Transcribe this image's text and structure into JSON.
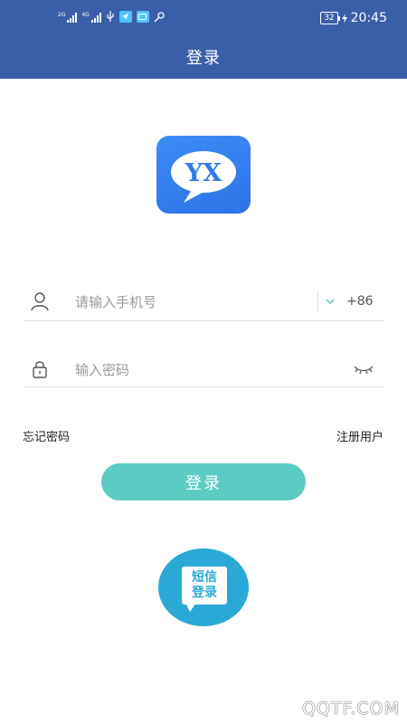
{
  "status_bar": {
    "signal_1_label": "2G",
    "signal_2_label": "4G",
    "battery": "32",
    "time": "20:45",
    "icons": [
      "signal-icon",
      "usb-icon",
      "notification-icon",
      "message-icon",
      "key-icon",
      "charging-icon"
    ]
  },
  "header": {
    "title": "登录",
    "background": "#3b5ea9"
  },
  "logo": {
    "text": "YX",
    "color": "#2f7aea"
  },
  "form": {
    "phone_placeholder": "请输入手机号",
    "phone_value": "",
    "country_code": "+86",
    "password_placeholder": "输入密码",
    "password_value": ""
  },
  "links": {
    "forgot": "忘记密码",
    "register": "注册用户"
  },
  "login_button": {
    "label": "登录",
    "color": "#5ccbc4"
  },
  "sms_login": {
    "line1": "短信",
    "line2": "登录",
    "color": "#2aa9d6"
  },
  "watermark": "QQTF.COM"
}
